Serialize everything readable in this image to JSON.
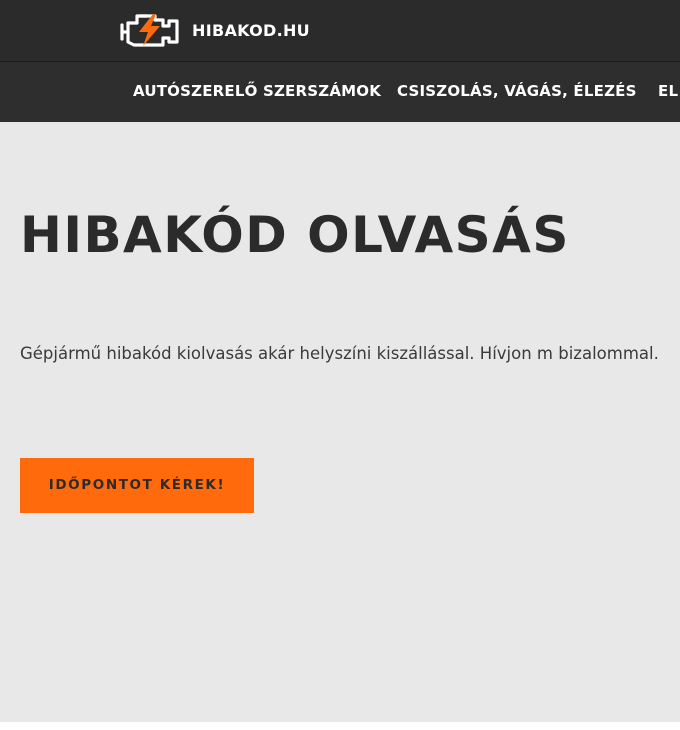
{
  "header": {
    "site_name": "HIBAKOD.HU",
    "logo_icon": "engine-check-icon",
    "accent_color": "#ff6a0c"
  },
  "nav": {
    "items": [
      {
        "label": "AUTÓSZERELŐ SZERSZÁMOK"
      },
      {
        "label": "CSISZOLÁS, VÁGÁS, ÉLEZÉS"
      },
      {
        "label": "EL"
      }
    ]
  },
  "hero": {
    "title": "HIBAKÓD OLVASÁS",
    "text": "Gépjármű hibakód kiolvasás akár helyszíni kiszállással. Hívjon m bizalommal.",
    "cta_label": "IDŐPONTOT KÉREK!"
  }
}
